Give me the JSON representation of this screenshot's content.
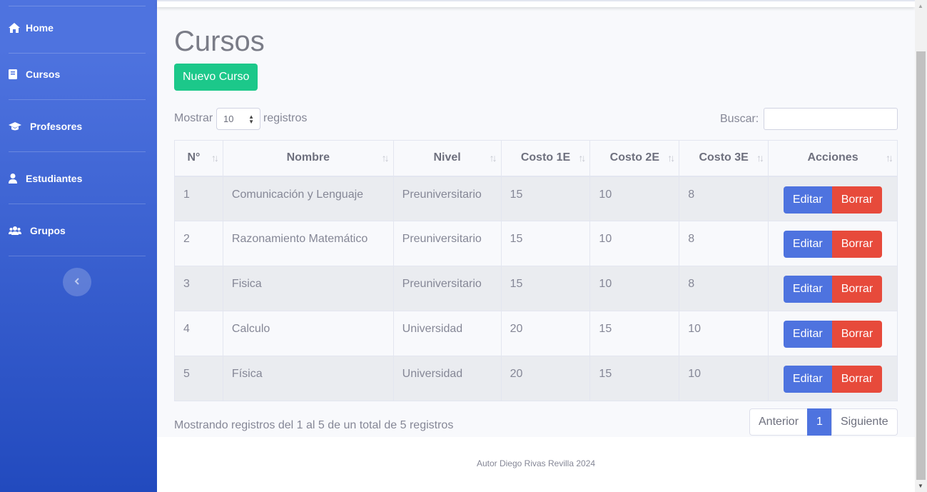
{
  "sidebar": {
    "items": [
      {
        "label": "Home",
        "icon": "home-icon"
      },
      {
        "label": "Cursos",
        "icon": "book-icon"
      },
      {
        "label": "Profesores",
        "icon": "graduation-cap-icon"
      },
      {
        "label": "Estudiantes",
        "icon": "user-icon"
      },
      {
        "label": "Grupos",
        "icon": "users-icon"
      }
    ],
    "toggle_icon": "chevron-left-icon"
  },
  "page": {
    "title": "Cursos",
    "new_button": "Nuevo Curso"
  },
  "table_controls": {
    "show_label": "Mostrar",
    "show_value": "10",
    "records_label": "registros",
    "search_label": "Buscar:",
    "search_value": ""
  },
  "table": {
    "headers": [
      "N°",
      "Nombre",
      "Nivel",
      "Costo 1E",
      "Costo 2E",
      "Costo 3E",
      "Acciones"
    ],
    "rows": [
      {
        "n": "1",
        "nombre": "Comunicación y Lenguaje",
        "nivel": "Preuniversitario",
        "c1": "15",
        "c2": "10",
        "c3": "8"
      },
      {
        "n": "2",
        "nombre": "Razonamiento Matemático",
        "nivel": "Preuniversitario",
        "c1": "15",
        "c2": "10",
        "c3": "8"
      },
      {
        "n": "3",
        "nombre": "Fisica",
        "nivel": "Preuniversitario",
        "c1": "15",
        "c2": "10",
        "c3": "8"
      },
      {
        "n": "4",
        "nombre": "Calculo",
        "nivel": "Universidad",
        "c1": "20",
        "c2": "15",
        "c3": "10"
      },
      {
        "n": "5",
        "nombre": "Física",
        "nivel": "Universidad",
        "c1": "20",
        "c2": "15",
        "c3": "10"
      }
    ],
    "edit_label": "Editar",
    "delete_label": "Borrar"
  },
  "pagination": {
    "info": "Mostrando registros del 1 al 5 de un total de 5 registros",
    "prev": "Anterior",
    "current": "1",
    "next": "Siguiente"
  },
  "footer": {
    "text": "Autor Diego Rivas Revilla 2024"
  },
  "colors": {
    "sidebar": "#4e73df",
    "success": "#1cc88a",
    "primary": "#4e73df",
    "danger": "#e74a3b"
  }
}
